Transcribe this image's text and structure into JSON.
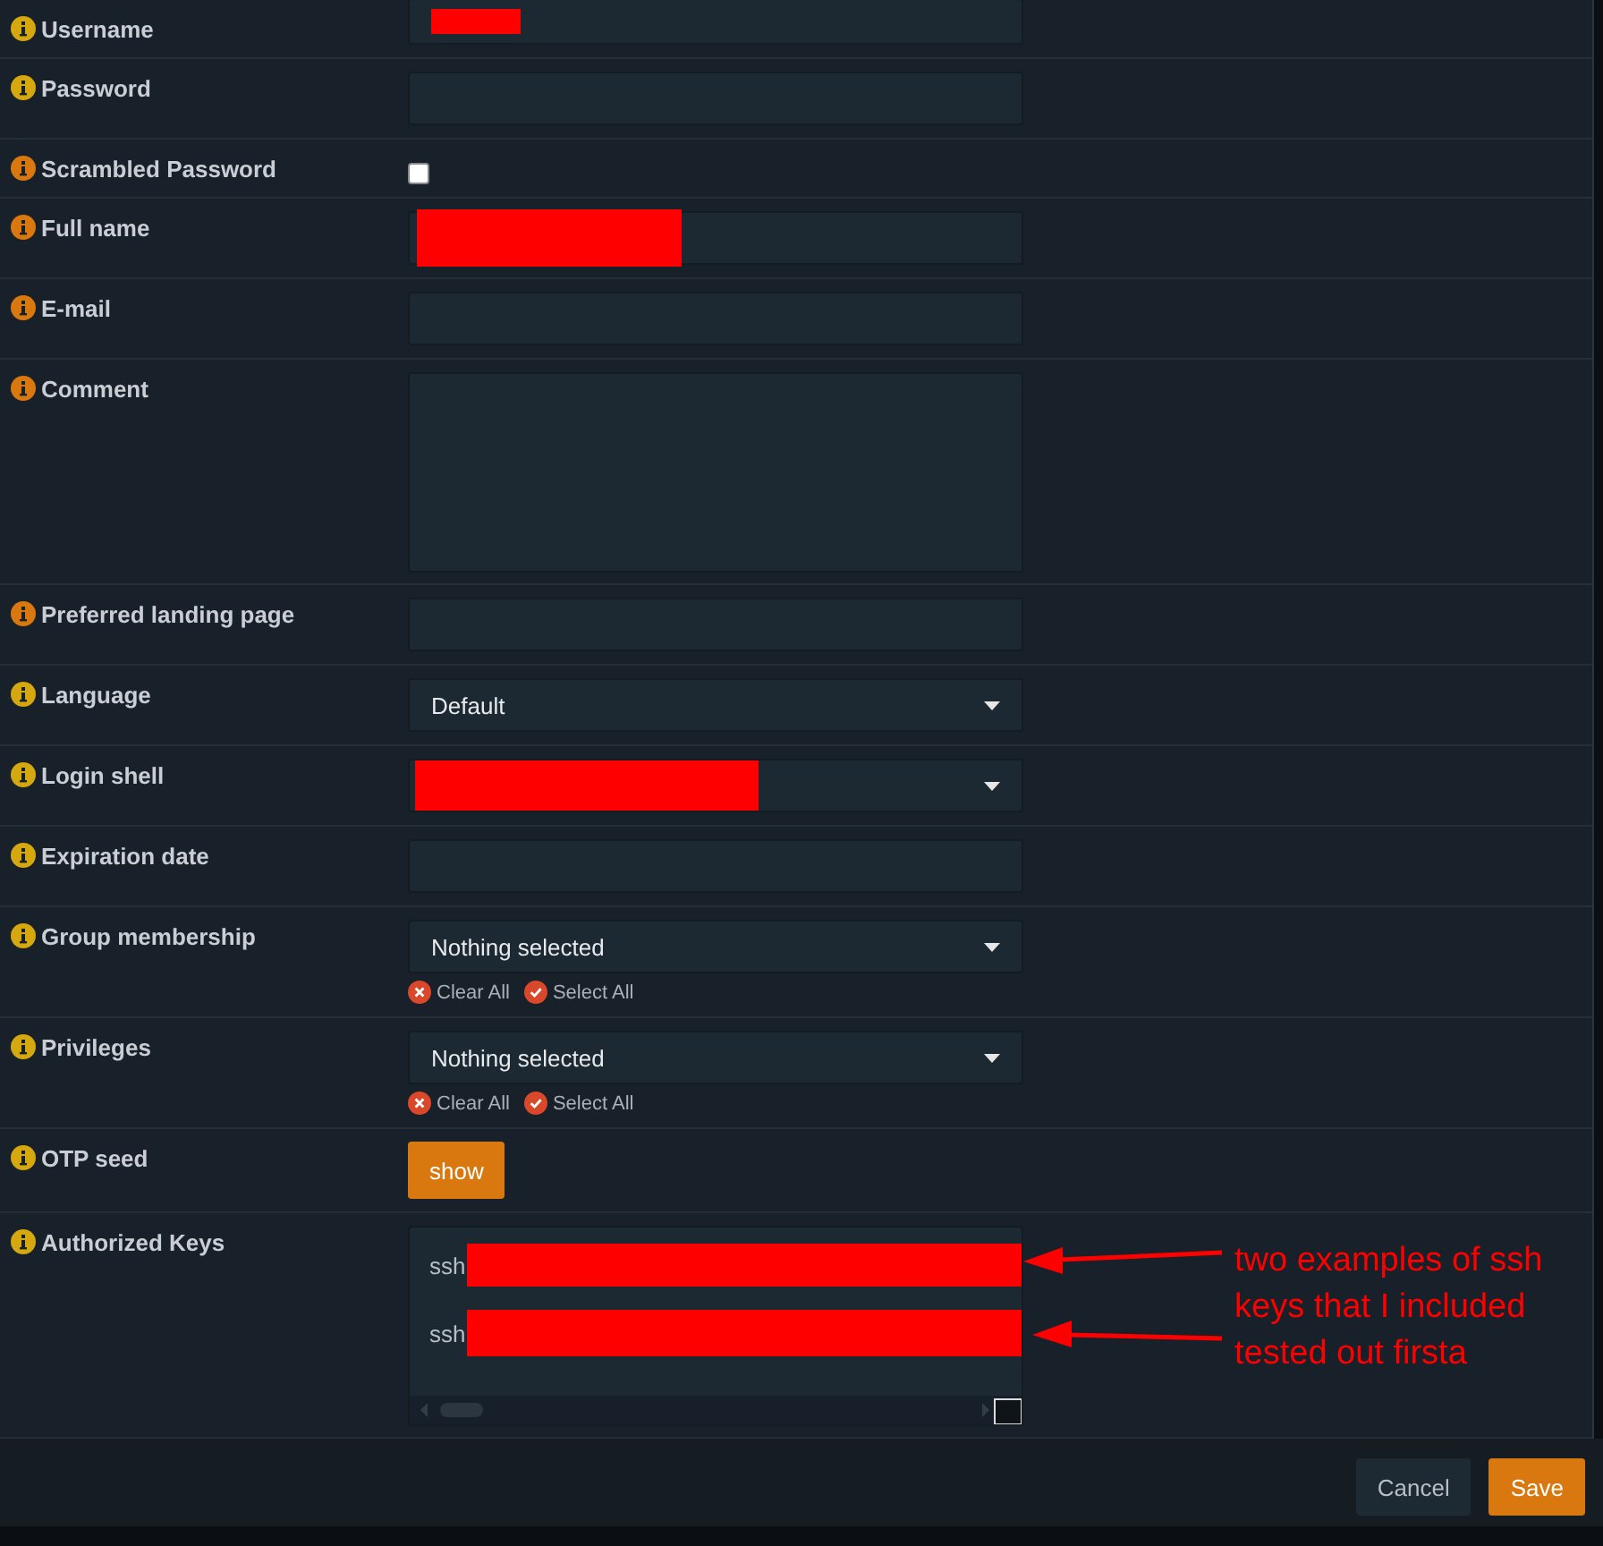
{
  "form": {
    "rows": [
      {
        "label": "Username",
        "color": "#d4a80e",
        "kind": "text",
        "redacted": true
      },
      {
        "label": "Password",
        "color": "#d4a80e",
        "kind": "password"
      },
      {
        "label": "Scrambled Password",
        "color": "#d9780f",
        "kind": "checkbox",
        "checked": false
      },
      {
        "label": "Full name",
        "color": "#d9780f",
        "kind": "text",
        "redacted": true
      },
      {
        "label": "E-mail",
        "color": "#d9780f",
        "kind": "text"
      },
      {
        "label": "Comment",
        "color": "#d9780f",
        "kind": "textarea"
      },
      {
        "label": "Preferred landing page",
        "color": "#d9780f",
        "kind": "text"
      },
      {
        "label": "Language",
        "color": "#d4a80e",
        "kind": "select",
        "value": "Default"
      },
      {
        "label": "Login shell",
        "color": "#d4a80e",
        "kind": "select",
        "redacted": true
      },
      {
        "label": "Expiration date",
        "color": "#d4a80e",
        "kind": "text"
      },
      {
        "label": "Group membership",
        "color": "#d4a80e",
        "kind": "multiselect",
        "value": "Nothing selected",
        "clear": "Clear All",
        "select_all": "Select All"
      },
      {
        "label": "Privileges",
        "color": "#d4a80e",
        "kind": "multiselect",
        "value": "Nothing selected",
        "clear": "Clear All",
        "select_all": "Select All"
      },
      {
        "label": "OTP seed",
        "color": "#d4a80e",
        "kind": "button",
        "button": "show"
      },
      {
        "label": "Authorized Keys",
        "color": "#d4a80e",
        "kind": "keys",
        "lines": [
          {
            "prefix": "ssh",
            "redacted": true
          },
          {
            "prefix": "ssh",
            "redacted": true
          }
        ]
      }
    ]
  },
  "annotation": {
    "text": "two examples of ssh\nkeys that I included\ntested out firsta"
  },
  "footer": {
    "buttons": [
      {
        "label": "Cancel",
        "kind": "secondary"
      },
      {
        "label": "Save",
        "kind": "primary"
      }
    ]
  }
}
